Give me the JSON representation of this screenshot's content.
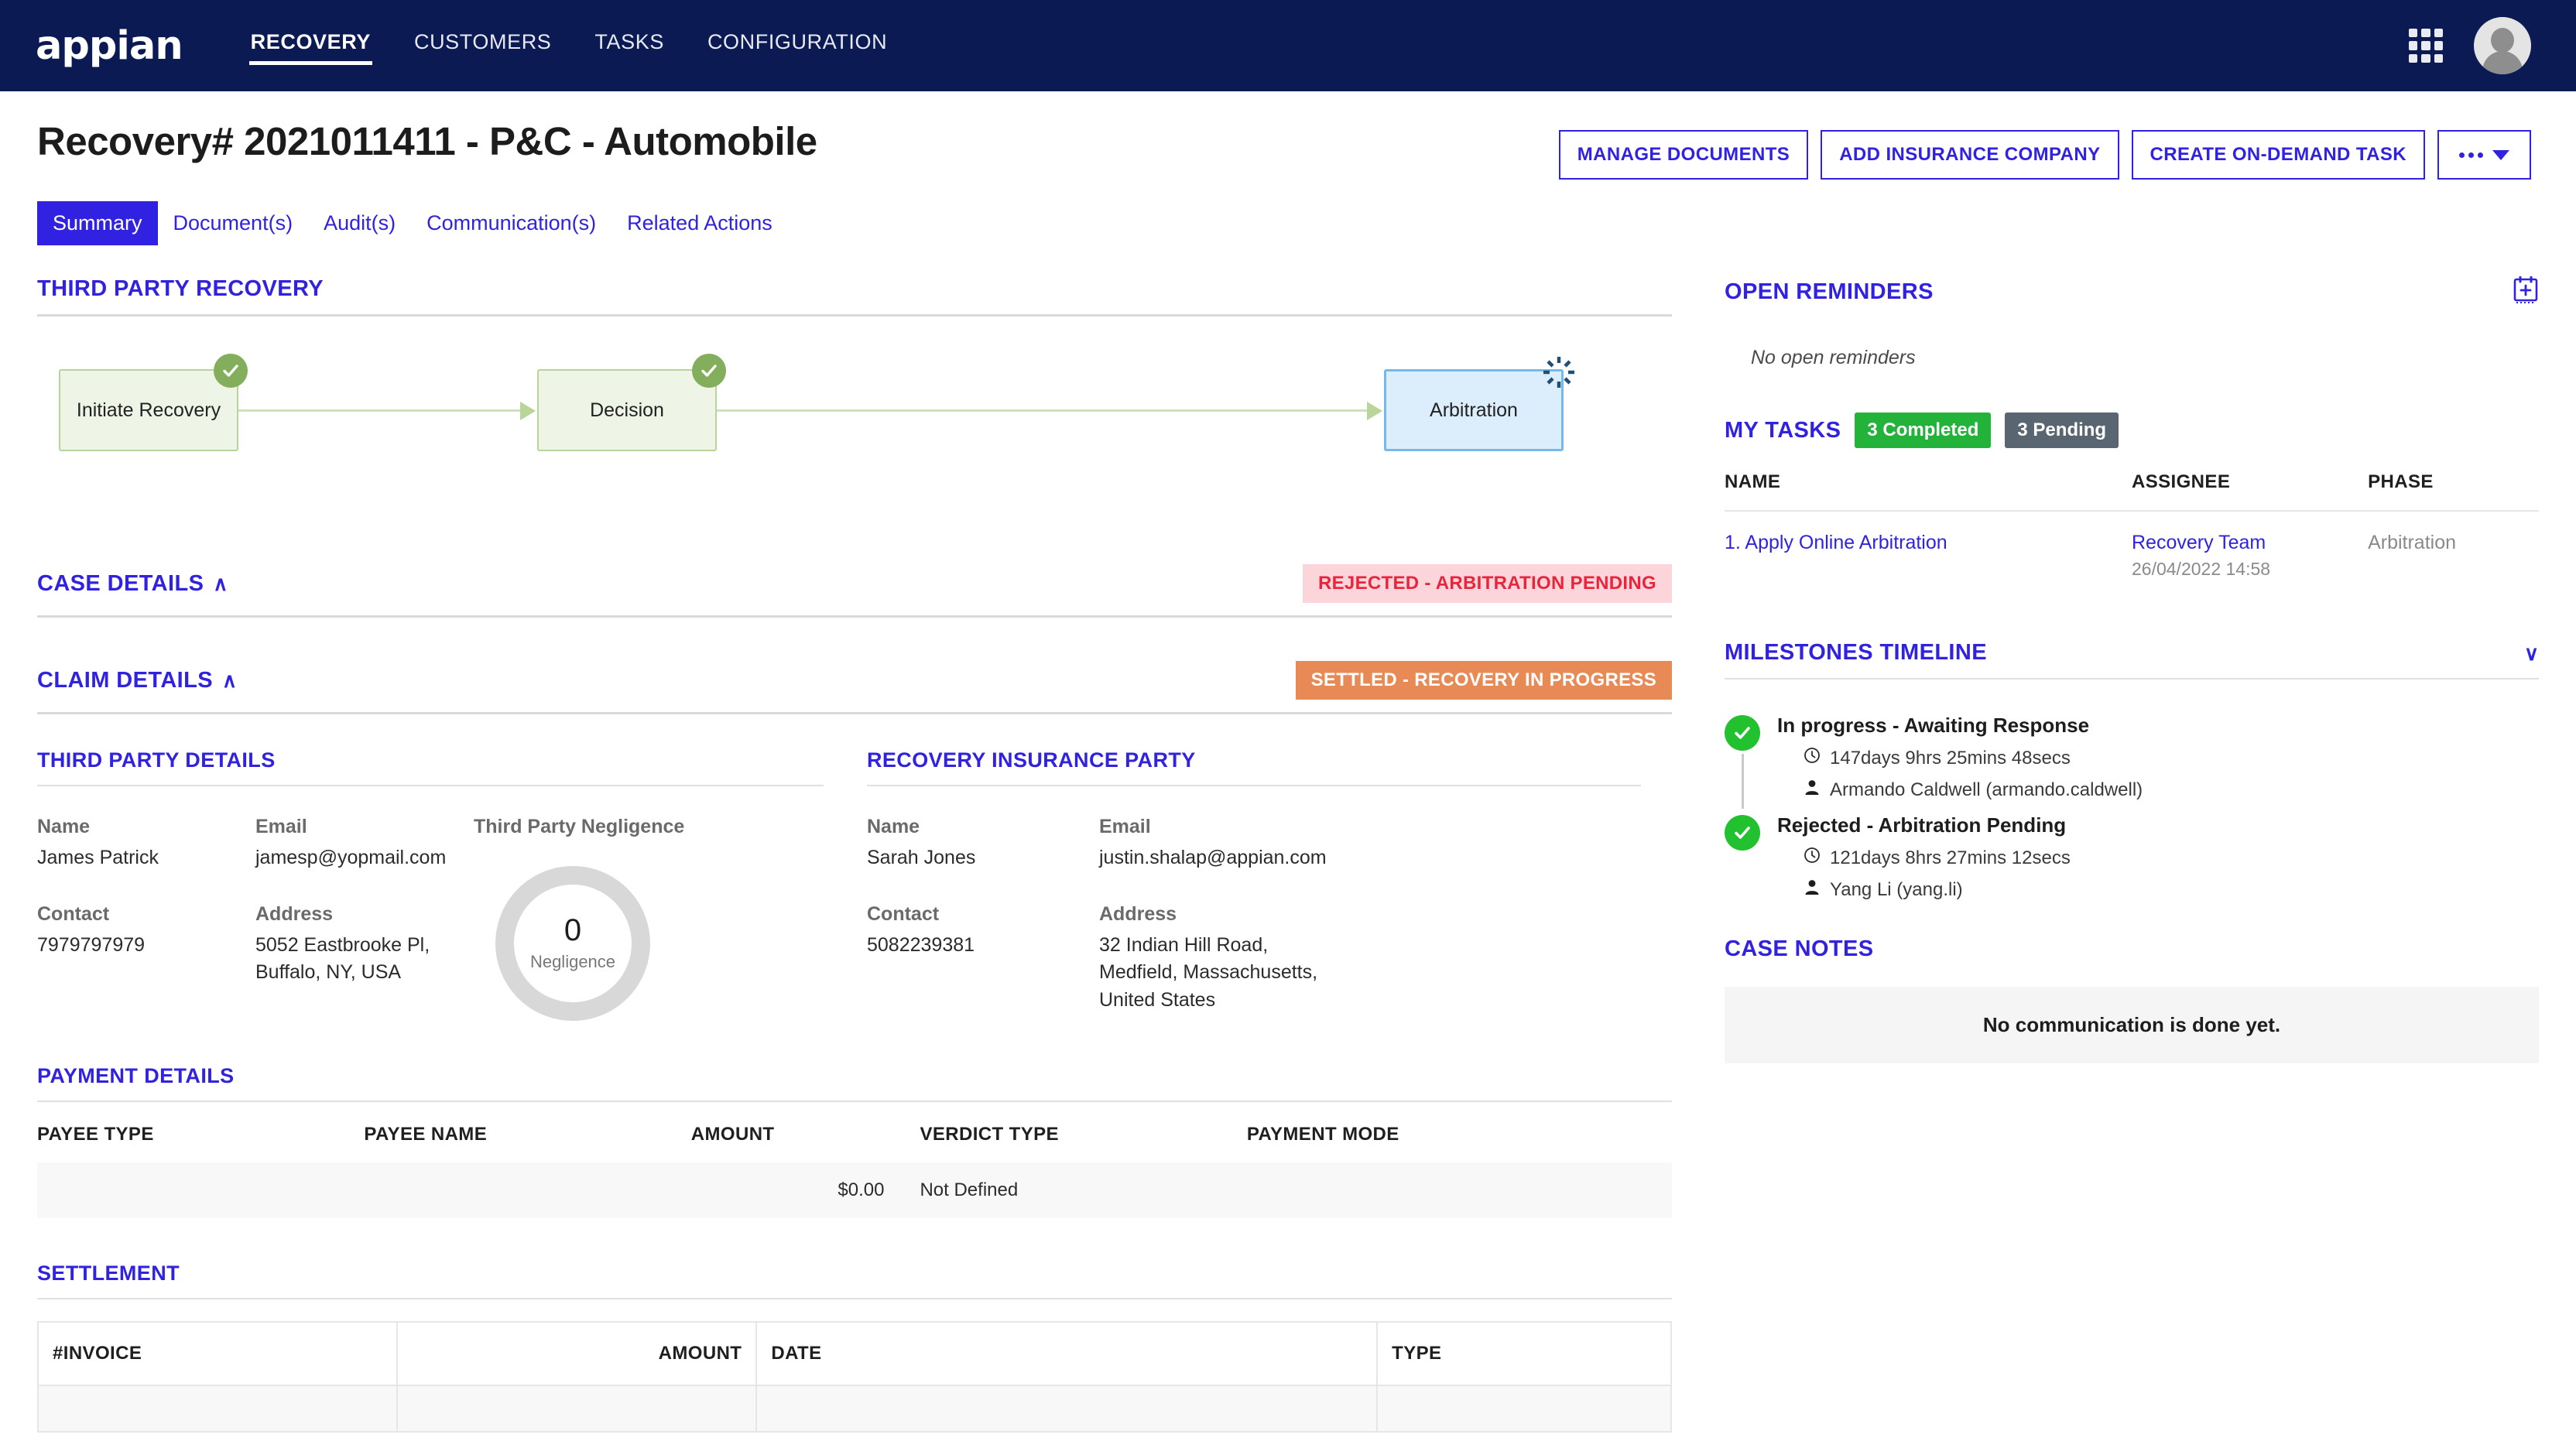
{
  "topnav": {
    "logo": "appian",
    "items": [
      {
        "label": "RECOVERY",
        "active": true
      },
      {
        "label": "CUSTOMERS",
        "active": false
      },
      {
        "label": "TASKS",
        "active": false
      },
      {
        "label": "CONFIGURATION",
        "active": false
      }
    ],
    "grid_icon": "apps-grid-icon",
    "avatar": "user-avatar"
  },
  "header": {
    "title": "Recovery# 2021011411 - P&C - Automobile",
    "actions": [
      "MANAGE DOCUMENTS",
      "ADD INSURANCE COMPANY",
      "CREATE ON-DEMAND TASK"
    ],
    "more_label": "more-actions"
  },
  "tabs": [
    {
      "label": "Summary",
      "active": true
    },
    {
      "label": "Document(s)",
      "active": false
    },
    {
      "label": "Audit(s)",
      "active": false
    },
    {
      "label": "Communication(s)",
      "active": false
    },
    {
      "label": "Related Actions",
      "active": false
    }
  ],
  "third_party_recovery": {
    "title": "THIRD PARTY RECOVERY",
    "nodes": [
      {
        "label": "Initiate Recovery",
        "state": "done"
      },
      {
        "label": "Decision",
        "state": "done"
      },
      {
        "label": "Arbitration",
        "state": "active"
      }
    ]
  },
  "case_details": {
    "title": "CASE DETAILS",
    "collapse_glyph": "∧",
    "status": "REJECTED - ARBITRATION PENDING"
  },
  "claim_details": {
    "title": "CLAIM DETAILS",
    "collapse_glyph": "∧",
    "status": "SETTLED - RECOVERY IN PROGRESS"
  },
  "third_party_details": {
    "title": "THIRD PARTY DETAILS",
    "name_label": "Name",
    "name_value": "James Patrick",
    "email_label": "Email",
    "email_value": "jamesp@yopmail.com",
    "contact_label": "Contact",
    "contact_value": "7979797979",
    "address_label": "Address",
    "address_value": "5052 Eastbrooke Pl, Buffalo, NY, USA",
    "negligence_label": "Third Party Negligence",
    "negligence_value": "0",
    "negligence_caption": "Negligence"
  },
  "recovery_insurance_party": {
    "title": "RECOVERY INSURANCE PARTY",
    "name_label": "Name",
    "name_value": "Sarah Jones",
    "email_label": "Email",
    "email_value": "justin.shalap@appian.com",
    "contact_label": "Contact",
    "contact_value": "5082239381",
    "address_label": "Address",
    "address_value": "32 Indian Hill Road, Medfield, Massachusetts, United States"
  },
  "payment_details": {
    "title": "PAYMENT DETAILS",
    "columns": [
      "PAYEE TYPE",
      "PAYEE NAME",
      "AMOUNT",
      "VERDICT TYPE",
      "PAYMENT MODE"
    ],
    "rows": [
      {
        "payee_type": "",
        "payee_name": "",
        "amount": "$0.00",
        "verdict_type": "Not Defined",
        "payment_mode": ""
      }
    ]
  },
  "settlement": {
    "title": "SETTLEMENT",
    "columns": [
      "#INVOICE",
      "AMOUNT",
      "DATE",
      "TYPE"
    ],
    "rows": [
      {
        "invoice": "",
        "amount": "",
        "date": "",
        "type": ""
      }
    ]
  },
  "open_reminders": {
    "title": "OPEN REMINDERS",
    "add_icon": "calendar-add-icon",
    "empty_text": "No open reminders"
  },
  "my_tasks": {
    "title": "MY TASKS",
    "completed_badge": "3 Completed",
    "pending_badge": "3 Pending",
    "columns": [
      "NAME",
      "ASSIGNEE",
      "PHASE"
    ],
    "rows": [
      {
        "name": "1. Apply Online Arbitration",
        "assignee": "Recovery Team",
        "assigned_at": "26/04/2022 14:58",
        "phase": "Arbitration"
      }
    ]
  },
  "milestones_timeline": {
    "title": "MILESTONES TIMELINE",
    "collapse_glyph": "∨",
    "items": [
      {
        "title": "In progress - Awaiting Response",
        "duration": "147days 9hrs 25mins 48secs",
        "user": "Armando Caldwell (armando.caldwell)"
      },
      {
        "title": "Rejected - Arbitration Pending",
        "duration": "121days 8hrs 27mins 12secs",
        "user": "Yang Li (yang.li)"
      }
    ]
  },
  "case_notes": {
    "title": "CASE NOTES",
    "empty_text": "No communication is done yet."
  },
  "colors": {
    "nav_bg": "#0b1a52",
    "accent": "#3022e0",
    "badge_rejected_bg": "#fcd5da",
    "badge_rejected_fg": "#e8253d",
    "badge_settled_bg": "#e88a56",
    "pill_green": "#23b23a",
    "pill_gray": "#596570",
    "node_done_bg": "#eef5e6",
    "node_active_bg": "#dcedfb"
  }
}
